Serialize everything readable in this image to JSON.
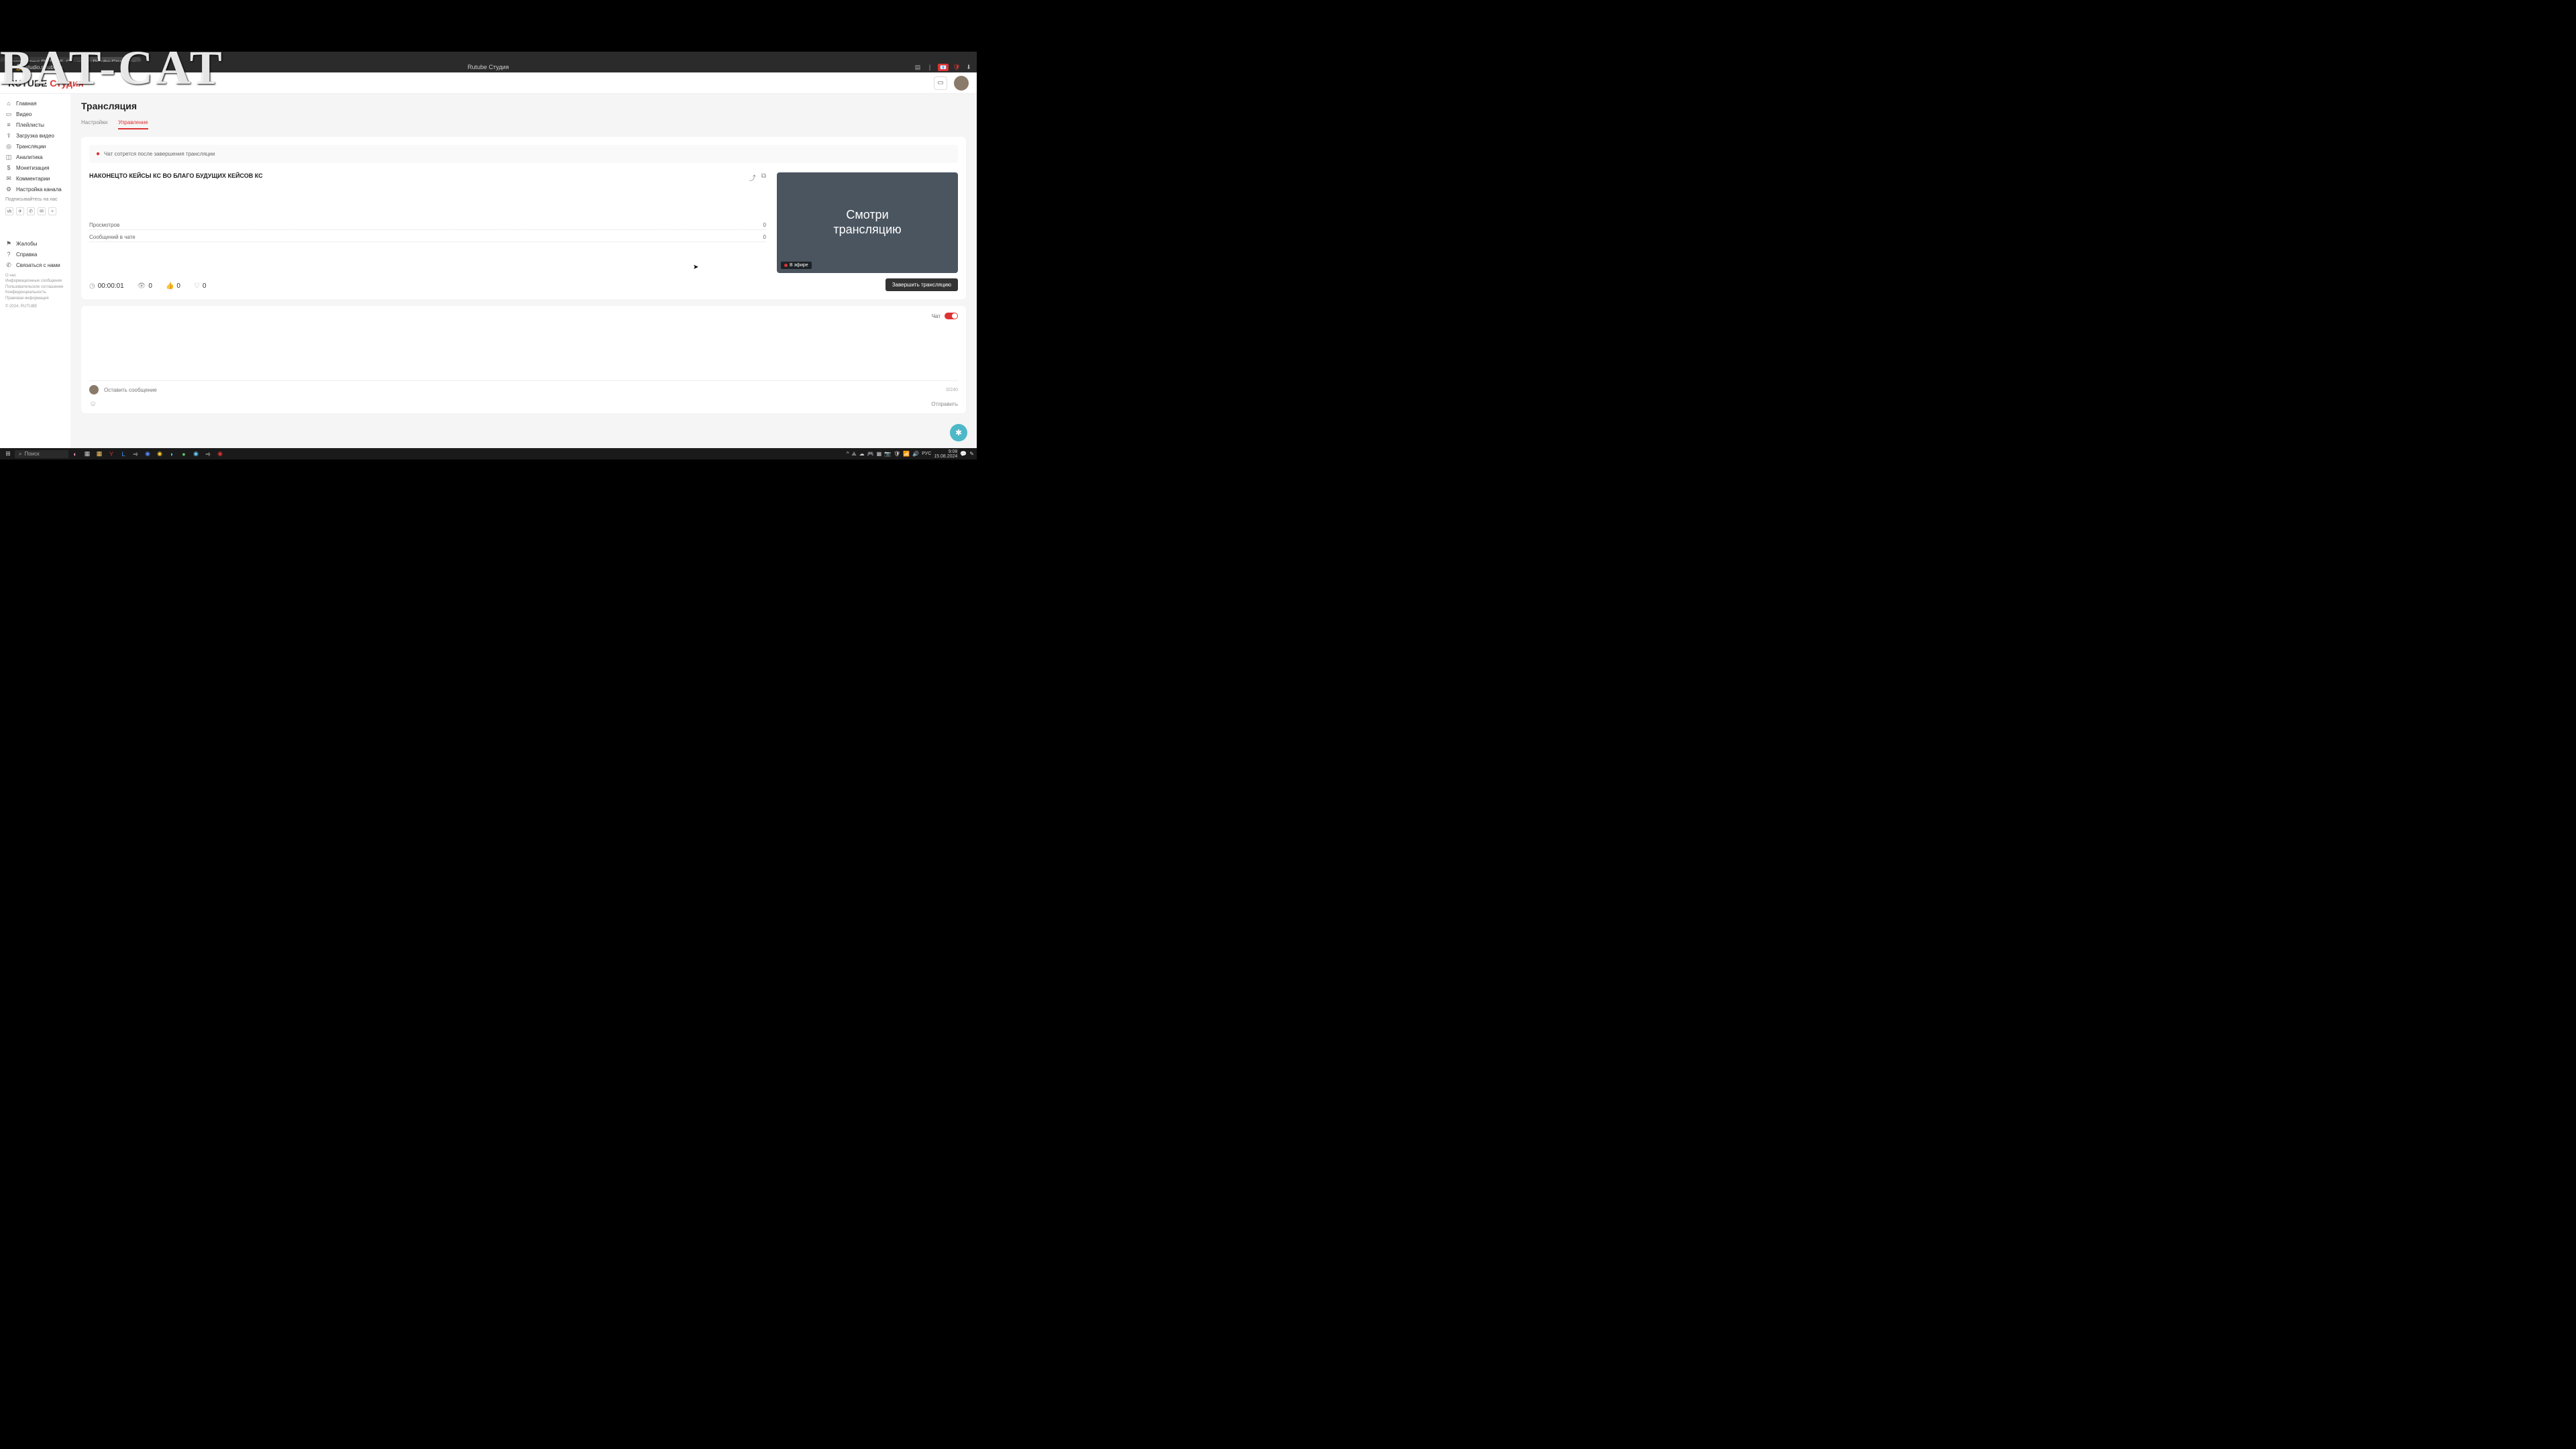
{
  "watermark": "BAT-CAT",
  "browser": {
    "tabs": [
      {
        "label": "Видеохостинг RUTUBE. С...",
        "active": false
      },
      {
        "label": "Rutube Студия",
        "active": true
      }
    ],
    "page_title": "Rutube Студия",
    "url": "studio.rutube.ru",
    "win": {
      "copy": "⧉",
      "min": "—",
      "max": "▢",
      "close": "✕"
    }
  },
  "header": {
    "logo_a": "RUTUBE",
    "logo_b": "Студия"
  },
  "sidebar": {
    "items": [
      {
        "icon": "⌂",
        "label": "Главная"
      },
      {
        "icon": "▭",
        "label": "Видео"
      },
      {
        "icon": "≡",
        "label": "Плейлисты"
      },
      {
        "icon": "⇪",
        "label": "Загрузка видео"
      },
      {
        "icon": "◎",
        "label": "Трансляции"
      },
      {
        "icon": "◫",
        "label": "Аналитика"
      },
      {
        "icon": "$",
        "label": "Монетизация"
      },
      {
        "icon": "✉",
        "label": "Комментарии"
      },
      {
        "icon": "⚙",
        "label": "Настройка канала"
      }
    ],
    "items2": [
      {
        "icon": "⚑",
        "label": "Жалобы"
      },
      {
        "icon": "?",
        "label": "Справка"
      },
      {
        "icon": "✆",
        "label": "Связаться с нами"
      }
    ],
    "social_label": "Подписывайтесь на нас",
    "socials": [
      "vk",
      "✈",
      "✆",
      "✉",
      "+"
    ],
    "footer": [
      "О нас",
      "Информационные сообщения",
      "Пользовательское соглашение",
      "Конфиденциальность",
      "Правовая информация"
    ],
    "copyright": "© 2024, RUTUBE"
  },
  "main": {
    "heading": "Трансляция",
    "tabs": [
      {
        "label": "Настройки",
        "active": false
      },
      {
        "label": "Управление",
        "active": true
      }
    ],
    "notice": "Чат сотрется после завершения трансляции",
    "stream_title": "НАКОНЕЦТО КЕЙСЫ КС ВО БЛАГО БУДУЩИХ КЕЙСОВ КС",
    "stats": [
      {
        "label": "Просмотров",
        "value": "0"
      },
      {
        "label": "Сообщений в чате",
        "value": "0"
      }
    ],
    "metrics": {
      "time": "00:00:01",
      "viewers": "0",
      "likes": "0",
      "hearts": "0"
    },
    "preview": {
      "line1": "Смотри",
      "line2": "трансляцию",
      "live_label": "В эфире"
    },
    "end_button": "Завершить трансляцию",
    "chat": {
      "label": "Чат",
      "placeholder": "Оставить сообщение",
      "counter": "0/240",
      "send": "Отправить"
    }
  },
  "taskbar": {
    "search": "Поиск",
    "lang": "РУС",
    "time": "9:08",
    "date": "15.08.2024"
  }
}
